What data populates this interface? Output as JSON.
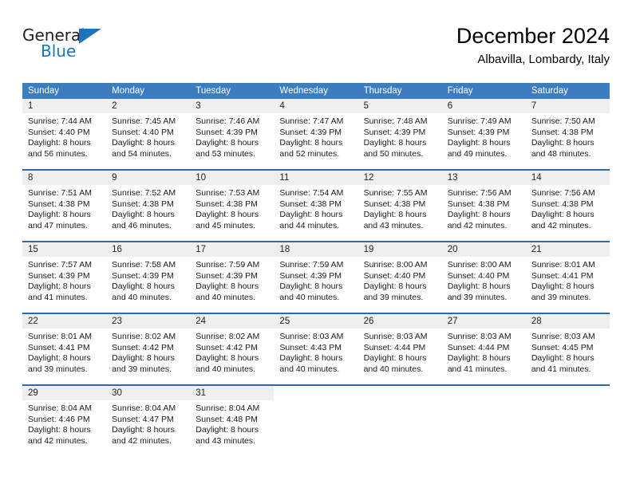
{
  "brand": {
    "name_part1": "General",
    "name_part2": "Blue",
    "accent_color": "#1b75bb"
  },
  "header": {
    "title": "December 2024",
    "location": "Albavilla, Lombardy, Italy"
  },
  "theme": {
    "header_row_bg": "#3b7dbf",
    "week_divider": "#2b6cab",
    "daynum_band_bg": "#efefef"
  },
  "weekdays": [
    "Sunday",
    "Monday",
    "Tuesday",
    "Wednesday",
    "Thursday",
    "Friday",
    "Saturday"
  ],
  "weeks": [
    [
      {
        "day": "1",
        "sunrise": "Sunrise: 7:44 AM",
        "sunset": "Sunset: 4:40 PM",
        "daylight_1": "Daylight: 8 hours",
        "daylight_2": "and 56 minutes."
      },
      {
        "day": "2",
        "sunrise": "Sunrise: 7:45 AM",
        "sunset": "Sunset: 4:40 PM",
        "daylight_1": "Daylight: 8 hours",
        "daylight_2": "and 54 minutes."
      },
      {
        "day": "3",
        "sunrise": "Sunrise: 7:46 AM",
        "sunset": "Sunset: 4:39 PM",
        "daylight_1": "Daylight: 8 hours",
        "daylight_2": "and 53 minutes."
      },
      {
        "day": "4",
        "sunrise": "Sunrise: 7:47 AM",
        "sunset": "Sunset: 4:39 PM",
        "daylight_1": "Daylight: 8 hours",
        "daylight_2": "and 52 minutes."
      },
      {
        "day": "5",
        "sunrise": "Sunrise: 7:48 AM",
        "sunset": "Sunset: 4:39 PM",
        "daylight_1": "Daylight: 8 hours",
        "daylight_2": "and 50 minutes."
      },
      {
        "day": "6",
        "sunrise": "Sunrise: 7:49 AM",
        "sunset": "Sunset: 4:39 PM",
        "daylight_1": "Daylight: 8 hours",
        "daylight_2": "and 49 minutes."
      },
      {
        "day": "7",
        "sunrise": "Sunrise: 7:50 AM",
        "sunset": "Sunset: 4:38 PM",
        "daylight_1": "Daylight: 8 hours",
        "daylight_2": "and 48 minutes."
      }
    ],
    [
      {
        "day": "8",
        "sunrise": "Sunrise: 7:51 AM",
        "sunset": "Sunset: 4:38 PM",
        "daylight_1": "Daylight: 8 hours",
        "daylight_2": "and 47 minutes."
      },
      {
        "day": "9",
        "sunrise": "Sunrise: 7:52 AM",
        "sunset": "Sunset: 4:38 PM",
        "daylight_1": "Daylight: 8 hours",
        "daylight_2": "and 46 minutes."
      },
      {
        "day": "10",
        "sunrise": "Sunrise: 7:53 AM",
        "sunset": "Sunset: 4:38 PM",
        "daylight_1": "Daylight: 8 hours",
        "daylight_2": "and 45 minutes."
      },
      {
        "day": "11",
        "sunrise": "Sunrise: 7:54 AM",
        "sunset": "Sunset: 4:38 PM",
        "daylight_1": "Daylight: 8 hours",
        "daylight_2": "and 44 minutes."
      },
      {
        "day": "12",
        "sunrise": "Sunrise: 7:55 AM",
        "sunset": "Sunset: 4:38 PM",
        "daylight_1": "Daylight: 8 hours",
        "daylight_2": "and 43 minutes."
      },
      {
        "day": "13",
        "sunrise": "Sunrise: 7:56 AM",
        "sunset": "Sunset: 4:38 PM",
        "daylight_1": "Daylight: 8 hours",
        "daylight_2": "and 42 minutes."
      },
      {
        "day": "14",
        "sunrise": "Sunrise: 7:56 AM",
        "sunset": "Sunset: 4:38 PM",
        "daylight_1": "Daylight: 8 hours",
        "daylight_2": "and 42 minutes."
      }
    ],
    [
      {
        "day": "15",
        "sunrise": "Sunrise: 7:57 AM",
        "sunset": "Sunset: 4:39 PM",
        "daylight_1": "Daylight: 8 hours",
        "daylight_2": "and 41 minutes."
      },
      {
        "day": "16",
        "sunrise": "Sunrise: 7:58 AM",
        "sunset": "Sunset: 4:39 PM",
        "daylight_1": "Daylight: 8 hours",
        "daylight_2": "and 40 minutes."
      },
      {
        "day": "17",
        "sunrise": "Sunrise: 7:59 AM",
        "sunset": "Sunset: 4:39 PM",
        "daylight_1": "Daylight: 8 hours",
        "daylight_2": "and 40 minutes."
      },
      {
        "day": "18",
        "sunrise": "Sunrise: 7:59 AM",
        "sunset": "Sunset: 4:39 PM",
        "daylight_1": "Daylight: 8 hours",
        "daylight_2": "and 40 minutes."
      },
      {
        "day": "19",
        "sunrise": "Sunrise: 8:00 AM",
        "sunset": "Sunset: 4:40 PM",
        "daylight_1": "Daylight: 8 hours",
        "daylight_2": "and 39 minutes."
      },
      {
        "day": "20",
        "sunrise": "Sunrise: 8:00 AM",
        "sunset": "Sunset: 4:40 PM",
        "daylight_1": "Daylight: 8 hours",
        "daylight_2": "and 39 minutes."
      },
      {
        "day": "21",
        "sunrise": "Sunrise: 8:01 AM",
        "sunset": "Sunset: 4:41 PM",
        "daylight_1": "Daylight: 8 hours",
        "daylight_2": "and 39 minutes."
      }
    ],
    [
      {
        "day": "22",
        "sunrise": "Sunrise: 8:01 AM",
        "sunset": "Sunset: 4:41 PM",
        "daylight_1": "Daylight: 8 hours",
        "daylight_2": "and 39 minutes."
      },
      {
        "day": "23",
        "sunrise": "Sunrise: 8:02 AM",
        "sunset": "Sunset: 4:42 PM",
        "daylight_1": "Daylight: 8 hours",
        "daylight_2": "and 39 minutes."
      },
      {
        "day": "24",
        "sunrise": "Sunrise: 8:02 AM",
        "sunset": "Sunset: 4:42 PM",
        "daylight_1": "Daylight: 8 hours",
        "daylight_2": "and 40 minutes."
      },
      {
        "day": "25",
        "sunrise": "Sunrise: 8:03 AM",
        "sunset": "Sunset: 4:43 PM",
        "daylight_1": "Daylight: 8 hours",
        "daylight_2": "and 40 minutes."
      },
      {
        "day": "26",
        "sunrise": "Sunrise: 8:03 AM",
        "sunset": "Sunset: 4:44 PM",
        "daylight_1": "Daylight: 8 hours",
        "daylight_2": "and 40 minutes."
      },
      {
        "day": "27",
        "sunrise": "Sunrise: 8:03 AM",
        "sunset": "Sunset: 4:44 PM",
        "daylight_1": "Daylight: 8 hours",
        "daylight_2": "and 41 minutes."
      },
      {
        "day": "28",
        "sunrise": "Sunrise: 8:03 AM",
        "sunset": "Sunset: 4:45 PM",
        "daylight_1": "Daylight: 8 hours",
        "daylight_2": "and 41 minutes."
      }
    ],
    [
      {
        "day": "29",
        "sunrise": "Sunrise: 8:04 AM",
        "sunset": "Sunset: 4:46 PM",
        "daylight_1": "Daylight: 8 hours",
        "daylight_2": "and 42 minutes."
      },
      {
        "day": "30",
        "sunrise": "Sunrise: 8:04 AM",
        "sunset": "Sunset: 4:47 PM",
        "daylight_1": "Daylight: 8 hours",
        "daylight_2": "and 42 minutes."
      },
      {
        "day": "31",
        "sunrise": "Sunrise: 8:04 AM",
        "sunset": "Sunset: 4:48 PM",
        "daylight_1": "Daylight: 8 hours",
        "daylight_2": "and 43 minutes."
      },
      {
        "day": "",
        "sunrise": "",
        "sunset": "",
        "daylight_1": "",
        "daylight_2": ""
      },
      {
        "day": "",
        "sunrise": "",
        "sunset": "",
        "daylight_1": "",
        "daylight_2": ""
      },
      {
        "day": "",
        "sunrise": "",
        "sunset": "",
        "daylight_1": "",
        "daylight_2": ""
      },
      {
        "day": "",
        "sunrise": "",
        "sunset": "",
        "daylight_1": "",
        "daylight_2": ""
      }
    ]
  ]
}
